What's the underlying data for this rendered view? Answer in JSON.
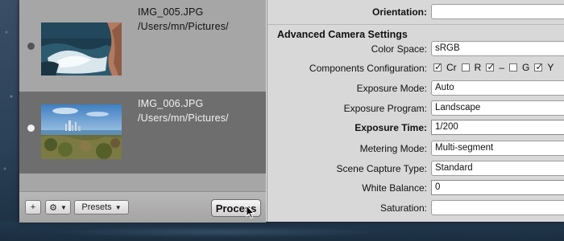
{
  "files": [
    {
      "name": "IMG_005.JPG",
      "path": "/Users/mn/Pictures/",
      "selected": false
    },
    {
      "name": "IMG_006.JPG",
      "path": "/Users/mn/Pictures/",
      "selected": true
    }
  ],
  "toolbar": {
    "add_label": "+",
    "presets_label": "Presets",
    "process_label": "Process"
  },
  "settings": {
    "orientation_label": "Orientation:",
    "orientation_value": "",
    "section_title": "Advanced Camera Settings",
    "color_space_label": "Color Space:",
    "color_space_value": "sRGB",
    "components_label": "Components Configuration:",
    "components": [
      {
        "label": "Cr",
        "checked": true,
        "box_first": true
      },
      {
        "label": "R",
        "checked": false,
        "box_first": false
      },
      {
        "label": "–",
        "checked": true,
        "box_first": true
      },
      {
        "label": "G",
        "checked": false,
        "box_first": false
      },
      {
        "label": "Y",
        "checked": true,
        "box_first": true
      }
    ],
    "exposure_mode_label": "Exposure Mode:",
    "exposure_mode_value": "Auto",
    "exposure_program_label": "Exposure Program:",
    "exposure_program_value": "Landscape",
    "exposure_time_label": "Exposure Time:",
    "exposure_time_value": "1/200",
    "metering_mode_label": "Metering Mode:",
    "metering_mode_value": "Multi-segment",
    "scene_capture_label": "Scene Capture Type:",
    "scene_capture_value": "Standard",
    "white_balance_label": "White Balance:",
    "white_balance_value": "0",
    "saturation_label": "Saturation:",
    "saturation_value": ""
  },
  "colors": {
    "selected_row": "#6e6e6e",
    "list_bg": "#a6a6a6",
    "panel_bg": "#d8d8d8"
  }
}
